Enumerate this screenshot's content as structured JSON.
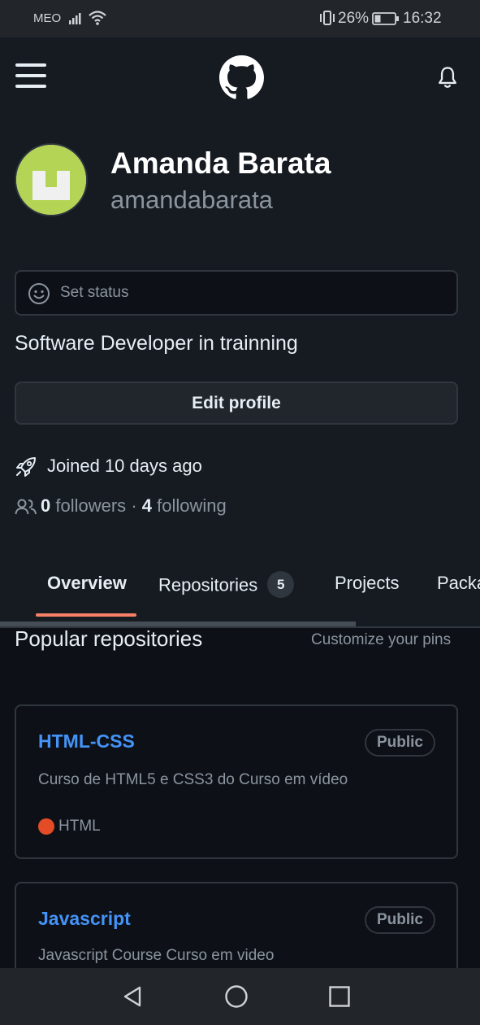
{
  "status_bar": {
    "carrier": "MEO",
    "battery_percent": "26%",
    "time": "16:32",
    "icons": [
      "signal-icon",
      "wifi-icon",
      "vibrate-icon",
      "battery-icon"
    ]
  },
  "header": {
    "icons": [
      "hamburger-menu-icon",
      "github-logo-icon",
      "bell-icon"
    ]
  },
  "profile": {
    "display_name": "Amanda Barata",
    "username": "amandabarata",
    "status_placeholder": "Set status",
    "bio": "Software Developer in trainning",
    "edit_button": "Edit profile",
    "joined": "Joined 10 days ago",
    "followers_count": "0",
    "followers_label": "followers",
    "separator": "·",
    "following_count": "4",
    "following_label": "following"
  },
  "tabs": [
    {
      "label": "Overview",
      "active": true
    },
    {
      "label": "Repositories",
      "count": "5"
    },
    {
      "label": "Projects"
    },
    {
      "label": "Packa"
    }
  ],
  "popular": {
    "title": "Popular repositories",
    "customize_label": "Customize your pins",
    "repos": [
      {
        "name": "HTML-CSS",
        "visibility": "Public",
        "description": "Curso de HTML5 e CSS3 do Curso em vídeo",
        "language": "HTML",
        "language_color": "#e34c26"
      },
      {
        "name": "Javascript",
        "visibility": "Public",
        "description": "Javascript Course Curso em video"
      }
    ]
  },
  "colors": {
    "background": "#0d1117",
    "header_bg": "#161b22",
    "link": "#4493f8",
    "tab_underline": "#f78166"
  },
  "nav_bar": {
    "icons": [
      "back-icon",
      "home-icon",
      "recents-icon"
    ]
  }
}
